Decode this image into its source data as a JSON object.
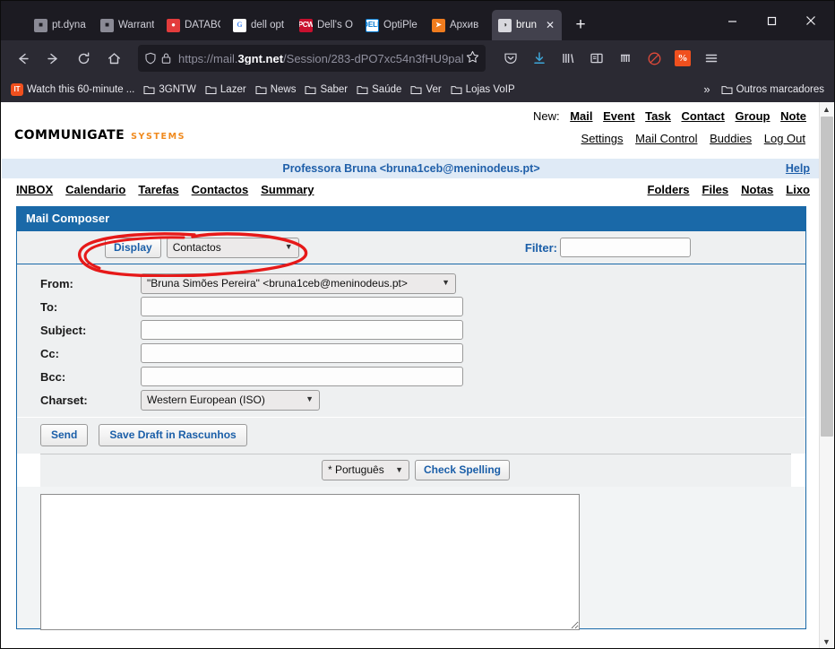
{
  "browser": {
    "tabs": [
      {
        "label": "pt.dyna",
        "favicon": "remote-desktop-icon",
        "active": false
      },
      {
        "label": "Warrant",
        "favicon": "remote-desktop-icon",
        "active": false
      },
      {
        "label": "DATABO",
        "favicon": "database-icon",
        "active": false
      },
      {
        "label": "dell opt",
        "favicon": "google-icon",
        "active": false
      },
      {
        "label": "Dell's O",
        "favicon": "pcworld-icon",
        "active": false
      },
      {
        "label": "OptiPle",
        "favicon": "dell-icon",
        "active": false
      },
      {
        "label": "Архив",
        "favicon": "archive-icon",
        "active": false
      },
      {
        "label": "brun",
        "favicon": "communigate-icon",
        "active": true
      }
    ],
    "new_tab_label": "+",
    "window_controls": {
      "minimize": "–",
      "maximize": "☐",
      "close": "✕"
    },
    "nav": {
      "back": "←",
      "forward": "→",
      "reload": "⟳",
      "home": "⌂"
    },
    "url": {
      "scheme_prefix": "https://mail.",
      "host": "3gnt.net",
      "path": "/Session/283-dPO7xc54n3fHU9pal",
      "full": "https://mail.3gnt.net/Session/283-dPO7xc54n3fHU9pal"
    },
    "toolbar_icons": [
      "pocket-icon",
      "downloads-icon",
      "library-icon",
      "sidebar-icon",
      "extensions-icon",
      "adblock-icon",
      "translate-badge-icon",
      "menu-icon"
    ],
    "bookmarks": [
      {
        "label": "Watch this 60-minute ...",
        "icon": "it-badge-icon"
      },
      {
        "label": "3GNTW",
        "icon": "folder-icon"
      },
      {
        "label": "Lazer",
        "icon": "folder-icon"
      },
      {
        "label": "News",
        "icon": "folder-icon"
      },
      {
        "label": "Saber",
        "icon": "folder-icon"
      },
      {
        "label": "Saúde",
        "icon": "folder-icon"
      },
      {
        "label": "Ver",
        "icon": "folder-icon"
      },
      {
        "label": "Lojas VoIP",
        "icon": "folder-icon"
      }
    ],
    "bookmarks_overflow": "»",
    "other_bookmarks": {
      "label": "Outros marcadores",
      "icon": "folder-icon"
    }
  },
  "app": {
    "logo": {
      "word": "CommuniGate",
      "suffix": "SYSTEMS",
      "suffix_color": "#f08a1e"
    },
    "new_menu": {
      "label": "New:",
      "items": [
        "Mail",
        "Event",
        "Task",
        "Contact",
        "Group",
        "Note"
      ]
    },
    "account_menu": [
      "Settings",
      "Mail Control",
      "Buddies",
      "Log Out"
    ],
    "userbar": {
      "user": "Professora Bruna <bruna1ceb@meninodeus.pt>",
      "help": "Help",
      "background": "#dfeaf6",
      "text_color": "#1f5fa9"
    },
    "nav_tabs": [
      "INBOX",
      "Calendario",
      "Tarefas",
      "Contactos",
      "Summary"
    ],
    "nav_right": [
      "Folders",
      "Files",
      "Notas",
      "Lixo"
    ]
  },
  "composer": {
    "title": "Mail Composer",
    "title_background": "#1a69a8",
    "display_bar": {
      "display_button": "Display",
      "display_select_value": "Contactos",
      "filter_label": "Filter:",
      "filter_value": "",
      "filter_placeholder": ""
    },
    "fields": [
      {
        "label": "From:",
        "type": "select",
        "value": "\"Bruna Simões Pereira\" <bruna1ceb@meninodeus.pt>"
      },
      {
        "label": "To:",
        "type": "text",
        "value": ""
      },
      {
        "label": "Subject:",
        "type": "text",
        "value": ""
      },
      {
        "label": "Cc:",
        "type": "text",
        "value": ""
      },
      {
        "label": "Bcc:",
        "type": "text",
        "value": ""
      },
      {
        "label": "Charset:",
        "type": "select",
        "value": "Western European (ISO)"
      }
    ],
    "actions": {
      "send": "Send",
      "save_draft": "Save Draft in Rascunhos"
    },
    "spelling": {
      "language_value": "* Português",
      "check_button": "Check Spelling"
    },
    "body_value": ""
  },
  "annotation": {
    "shape": "ellipse",
    "color": "#e61919",
    "targets": [
      "Display",
      "Contactos"
    ]
  }
}
